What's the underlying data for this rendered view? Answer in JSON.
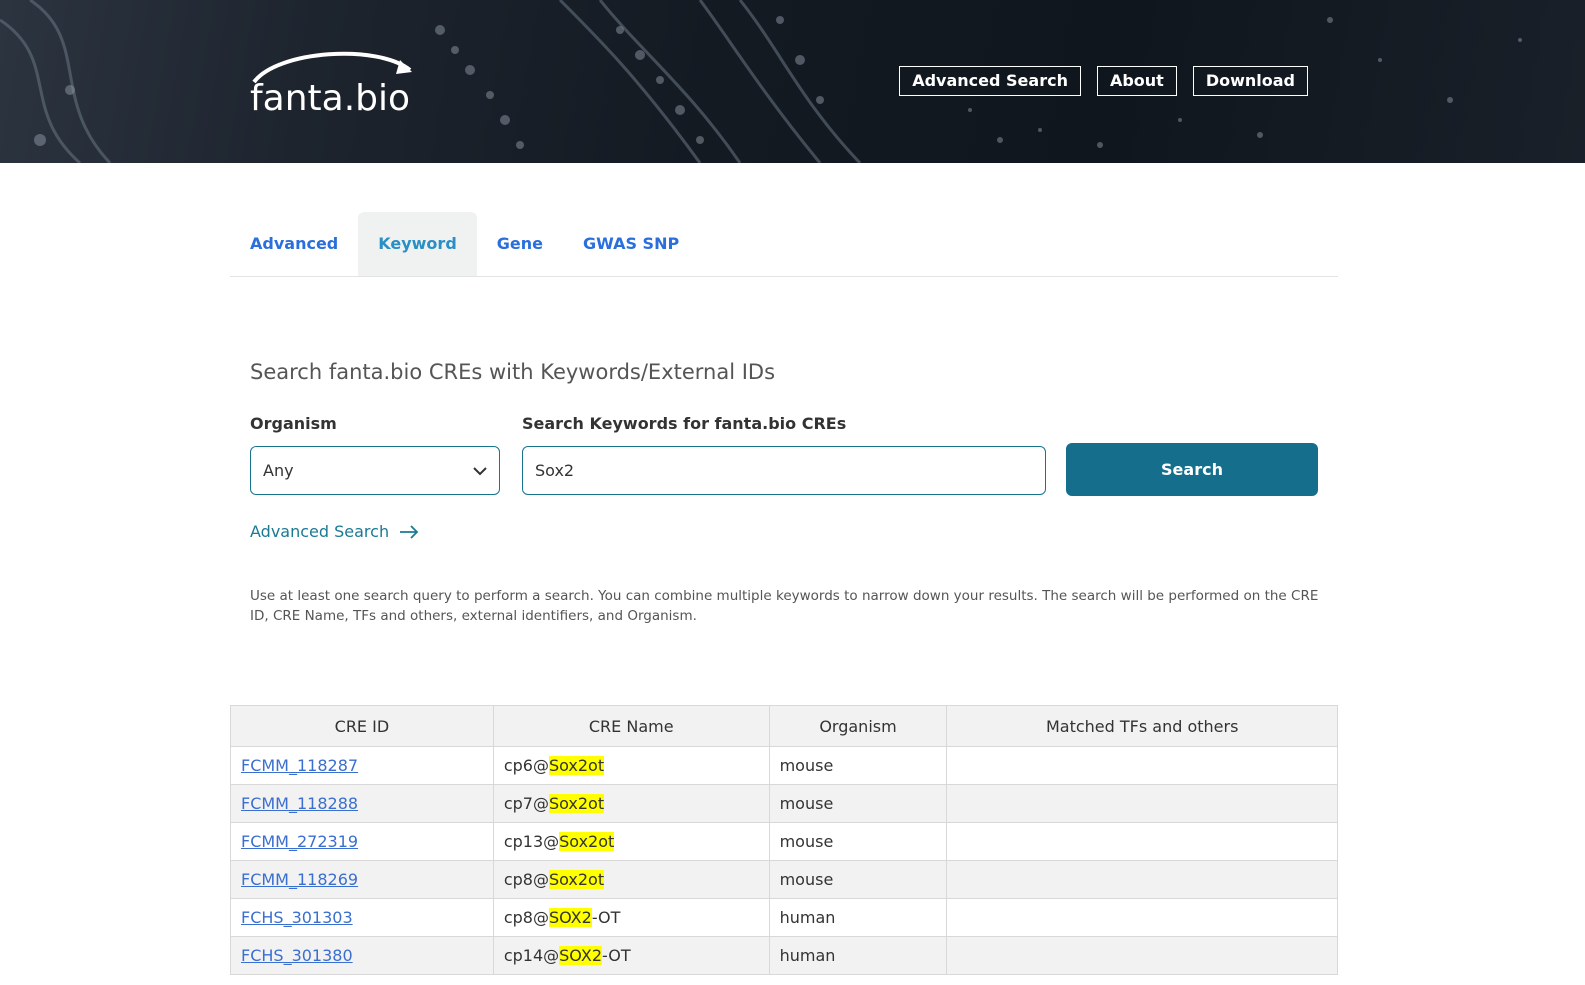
{
  "header": {
    "logo_text": "fanta.bio",
    "nav": [
      "Advanced Search",
      "About",
      "Download"
    ]
  },
  "tabs": {
    "items": [
      "Advanced",
      "Keyword",
      "Gene",
      "GWAS SNP"
    ],
    "active": "Keyword"
  },
  "search": {
    "heading": "Search fanta.bio CREs with Keywords/External IDs",
    "organism_label": "Organism",
    "organism_value": "Any",
    "keyword_label": "Search Keywords for fanta.bio CREs",
    "keyword_value": "Sox2",
    "button_label": "Search",
    "advanced_link": "Advanced Search",
    "help_text": "Use at least one search query to perform a search. You can combine multiple keywords to narrow down your results. The search will be performed on the CRE ID, CRE Name, TFs and others, external identifiers, and Organism."
  },
  "table": {
    "columns": [
      "CRE ID",
      "CRE Name",
      "Organism",
      "Matched TFs and others"
    ],
    "rows": [
      {
        "id": "FCMM_118287",
        "name_pre": "cp6@",
        "name_hl": "Sox2ot",
        "name_post": "",
        "organism": "mouse",
        "matched": ""
      },
      {
        "id": "FCMM_118288",
        "name_pre": "cp7@",
        "name_hl": "Sox2ot",
        "name_post": "",
        "organism": "mouse",
        "matched": ""
      },
      {
        "id": "FCMM_272319",
        "name_pre": "cp13@",
        "name_hl": "Sox2ot",
        "name_post": "",
        "organism": "mouse",
        "matched": ""
      },
      {
        "id": "FCMM_118269",
        "name_pre": "cp8@",
        "name_hl": "Sox2ot",
        "name_post": "",
        "organism": "mouse",
        "matched": ""
      },
      {
        "id": "FCHS_301303",
        "name_pre": "cp8@",
        "name_hl": "SOX2",
        "name_post": "-OT",
        "organism": "human",
        "matched": ""
      },
      {
        "id": "FCHS_301380",
        "name_pre": "cp14@",
        "name_hl": "SOX2",
        "name_post": "-OT",
        "organism": "human",
        "matched": ""
      }
    ]
  },
  "colors": {
    "accent": "#156f8c",
    "link": "#3a6fcf",
    "tab_link": "#2a6fdb",
    "highlight": "#ffff00"
  }
}
